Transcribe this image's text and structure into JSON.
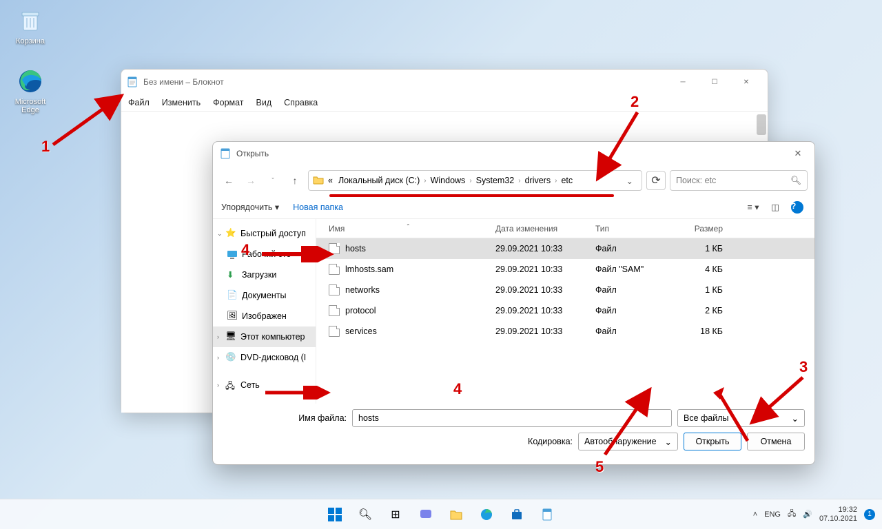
{
  "desktop": {
    "recycle": "Корзина",
    "edge": "Microsoft Edge"
  },
  "notepad": {
    "title": "Без имени – Блокнот",
    "menu": {
      "file": "Файл",
      "edit": "Изменить",
      "format": "Формат",
      "view": "Вид",
      "help": "Справка"
    }
  },
  "dialog": {
    "title": "Открыть",
    "breadcrumb": {
      "prefix": "«",
      "c0": "Локальный диск (C:)",
      "c1": "Windows",
      "c2": "System32",
      "c3": "drivers",
      "c4": "etc"
    },
    "search_placeholder": "Поиск: etc",
    "toolbar": {
      "organize": "Упорядочить",
      "new_folder": "Новая папка"
    },
    "sidebar": {
      "quick": "Быстрый доступ",
      "desktop": "Рабочий сто",
      "downloads": "Загрузки",
      "documents": "Документы",
      "pictures": "Изображен",
      "thispc": "Этот компьютер",
      "dvd": "DVD-дисковод (I",
      "network": "Сеть"
    },
    "columns": {
      "name": "Имя",
      "date": "Дата изменения",
      "type": "Тип",
      "size": "Размер"
    },
    "files": [
      {
        "name": "hosts",
        "date": "29.09.2021 10:33",
        "type": "Файл",
        "size": "1 КБ",
        "sel": true
      },
      {
        "name": "lmhosts.sam",
        "date": "29.09.2021 10:33",
        "type": "Файл \"SAM\"",
        "size": "4 КБ"
      },
      {
        "name": "networks",
        "date": "29.09.2021 10:33",
        "type": "Файл",
        "size": "1 КБ"
      },
      {
        "name": "protocol",
        "date": "29.09.2021 10:33",
        "type": "Файл",
        "size": "2 КБ"
      },
      {
        "name": "services",
        "date": "29.09.2021 10:33",
        "type": "Файл",
        "size": "18 КБ"
      }
    ],
    "filename_label": "Имя файла:",
    "filename_value": "hosts",
    "filter": "Все файлы",
    "encoding_label": "Кодировка:",
    "encoding_value": "Автообнаружение",
    "open": "Открыть",
    "cancel": "Отмена"
  },
  "annotations": {
    "n1": "1",
    "n2": "2",
    "n3": "3",
    "n4": "4",
    "n5": "5"
  },
  "taskbar": {
    "lang": "ENG",
    "time": "19:32",
    "date": "07.10.2021"
  }
}
